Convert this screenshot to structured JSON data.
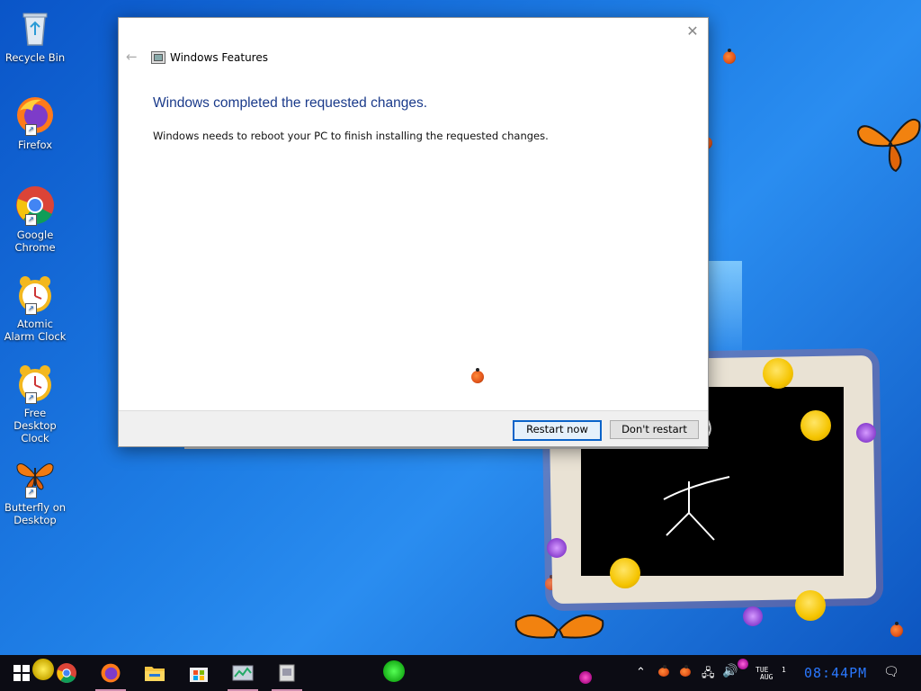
{
  "desktop": {
    "icons": [
      {
        "label": "Recycle Bin"
      },
      {
        "label": "Firefox"
      },
      {
        "label": "Google Chrome"
      },
      {
        "label": "Atomic Alarm Clock"
      },
      {
        "label": "Free Desktop Clock"
      },
      {
        "label": "Butterfly on Desktop"
      }
    ]
  },
  "dialog": {
    "title": "Windows Features",
    "heading": "Windows completed the requested changes.",
    "message": "Windows needs to reboot your PC to finish installing the requested changes.",
    "restart_now_label": "Restart now",
    "dont_restart_label": "Don't restart"
  },
  "taskbar": {
    "pinned": [
      "start",
      "chrome",
      "firefox",
      "file-explorer",
      "microsoft-store",
      "task-manager",
      "recycle-bin-app"
    ],
    "tray": {
      "day": "TUE",
      "month": "AUG",
      "date": "1",
      "time": "08:44PM"
    }
  },
  "colors": {
    "accent": "#0a63c9",
    "heading": "#1a3a8a",
    "desktop_blue": "#1f7fe6"
  }
}
